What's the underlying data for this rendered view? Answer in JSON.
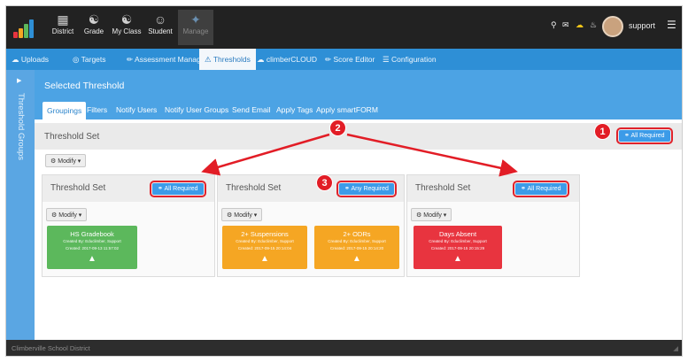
{
  "topnav": {
    "items": [
      {
        "label": "District",
        "icon": "district-icon"
      },
      {
        "label": "Grade",
        "icon": "grade-icon"
      },
      {
        "label": "My Class",
        "icon": "class-icon"
      },
      {
        "label": "Student",
        "icon": "student-icon"
      },
      {
        "label": "Manage",
        "icon": "manage-icon"
      }
    ],
    "username": "support"
  },
  "subnav": {
    "items": [
      "Uploads",
      "Targets",
      "Assessment Manager",
      "Thresholds",
      "climberCLOUD",
      "Score Editor",
      "Configuration"
    ]
  },
  "sidebar": {
    "label": "Threshold Groups"
  },
  "header": {
    "title": "Selected Threshold"
  },
  "tabs": [
    "Groupings",
    "Filters",
    "Notify Users",
    "Notify User Groups",
    "Send Email",
    "Apply Tags",
    "Apply smartFORM"
  ],
  "threshold_set": {
    "label": "Threshold Set",
    "button": "All Required",
    "modify": "Modify"
  },
  "groups": [
    {
      "title": "Threshold Set",
      "button": "All Required",
      "modify": "Modify"
    },
    {
      "title": "Threshold Set",
      "button": "Any Required",
      "modify": "Modify"
    },
    {
      "title": "Threshold Set",
      "button": "All Required",
      "modify": "Modify"
    }
  ],
  "cards": [
    {
      "title": "HS Gradebook",
      "created_by": "Created By: Educlimber, Support",
      "created": "Created: 2017-09-13 11:57:02",
      "color": "#5cb85c"
    },
    {
      "title": "2+ Suspensions",
      "created_by": "Created By: Educlimber, Support",
      "created": "Created: 2017-09-15 20:14:04",
      "color": "#f5a623"
    },
    {
      "title": "2+ ODRs",
      "created_by": "Created By: Educlimber, Support",
      "created": "Created: 2017-09-15 20:14:20",
      "color": "#f5a623"
    },
    {
      "title": "Days Absent",
      "created_by": "Created By: Educlimber, Support",
      "created": "Created: 2017-09-15 20:15:29",
      "color": "#e8343f"
    }
  ],
  "callouts": [
    "1",
    "2",
    "3"
  ],
  "footer": {
    "text": "Climberville School District"
  },
  "colors": {
    "primary": "#2e8fd6",
    "header": "#4ca3e4",
    "annotation": "#e21d26"
  }
}
